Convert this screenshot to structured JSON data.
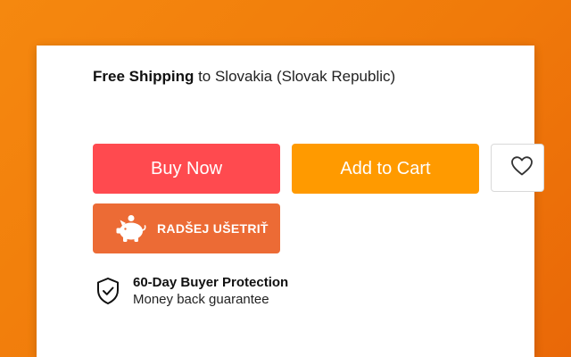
{
  "shipping": {
    "bold_text": "Free Shipping",
    "rest_text": " to Slovakia (Slovak Republic)"
  },
  "actions": {
    "buy_now_label": "Buy Now",
    "add_to_cart_label": "Add to Cart",
    "wishlist_icon": "heart-icon",
    "save_label": "RADŠEJ UŠETRIŤ",
    "save_icon": "piggy-bank-icon"
  },
  "protection": {
    "icon": "shield-check-icon",
    "title": "60-Day Buyer Protection",
    "subtitle": "Money back guarantee"
  },
  "colors": {
    "background": "#f07a0a",
    "buy_now": "#ff4a4f",
    "add_to_cart": "#ff9a00",
    "save_button": "#ec6b35"
  }
}
